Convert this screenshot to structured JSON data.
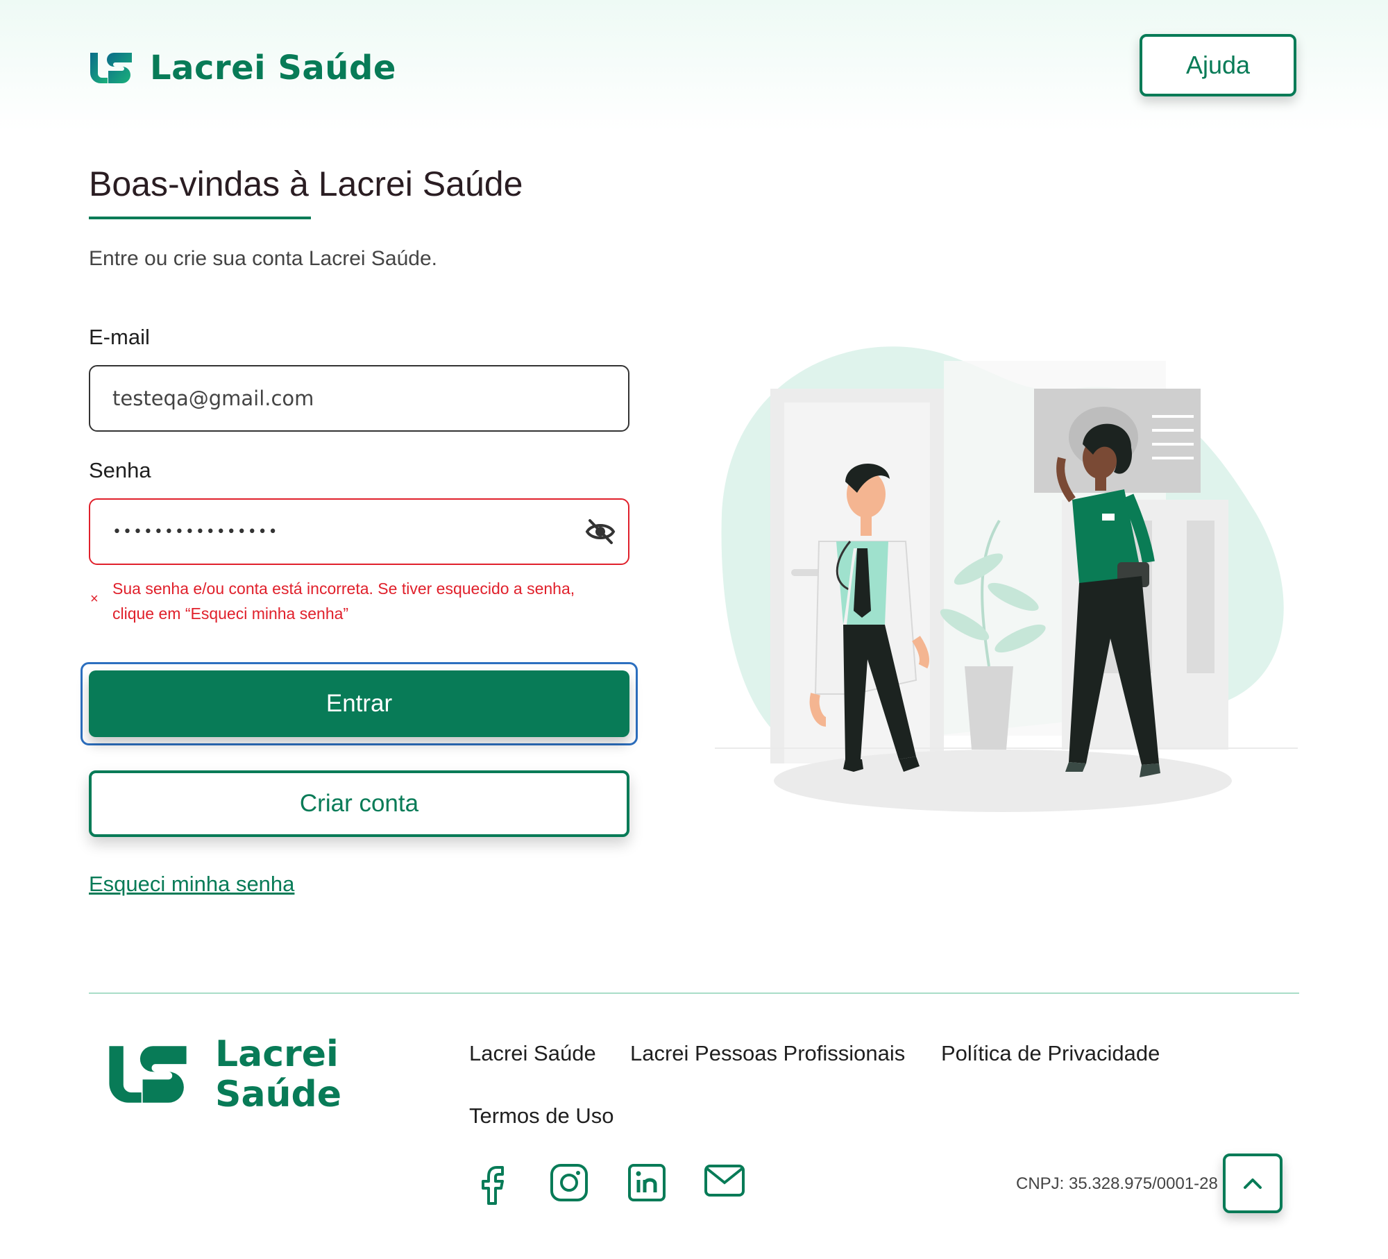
{
  "brand": {
    "name": "Lacrei Saúde",
    "color": "#087b57",
    "error_color": "#e0202b"
  },
  "header": {
    "help_label": "Ajuda"
  },
  "main": {
    "title": "Boas-vindas à Lacrei Saúde",
    "subtitle": "Entre ou crie sua conta Lacrei Saúde.",
    "email_label": "E-mail",
    "email_value": "testeqa@gmail.com",
    "password_label": "Senha",
    "password_masked": "••••••••••••••••",
    "error_line1": "Sua senha e/ou conta está incorreta. Se tiver esquecido a senha,",
    "error_line2": "clique em “Esqueci minha senha”",
    "error_icon": "×",
    "login_button": "Entrar",
    "create_button": "Criar conta",
    "forgot_link": "Esqueci minha senha"
  },
  "footer": {
    "logo_line1": "Lacrei",
    "logo_line2": "Saúde",
    "links": [
      "Lacrei Saúde",
      "Lacrei Pessoas Profissionais",
      "Política de Privacidade",
      "Termos de Uso"
    ],
    "social_icons": [
      "facebook-icon",
      "instagram-icon",
      "linkedin-icon",
      "mail-icon"
    ],
    "cnpj": "CNPJ: 35.328.975/0001-28"
  }
}
